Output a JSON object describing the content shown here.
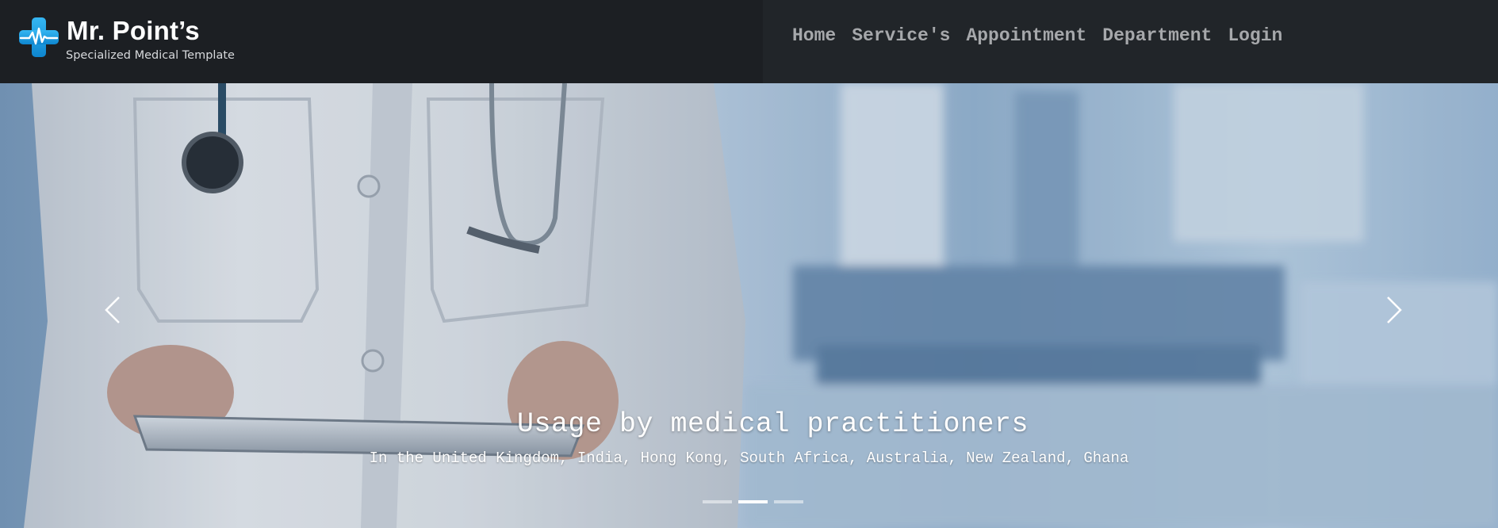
{
  "brand": {
    "name": "Mr. Point’s",
    "tagline": "Specialized Medical Template",
    "icon": "medical-cross-heartbeat-icon",
    "accent_color": "#1e9fe3"
  },
  "nav": {
    "items": [
      {
        "label": "Home"
      },
      {
        "label": "Service's"
      },
      {
        "label": "Appointment"
      },
      {
        "label": "Department"
      },
      {
        "label": "Login"
      }
    ]
  },
  "hero": {
    "title": "Usage by medical practitioners",
    "subtitle": "In the United Kingdom, India, Hong Kong, South Africa, Australia, New Zealand, Ghana",
    "prev_icon": "chevron-left-icon",
    "next_icon": "chevron-right-icon",
    "indicators": {
      "count": 3,
      "active_index": 1
    }
  },
  "colors": {
    "navbar_bg": "#1c1f23",
    "nav_text": "#a6a8ab",
    "caption_text": "#ffffff"
  }
}
